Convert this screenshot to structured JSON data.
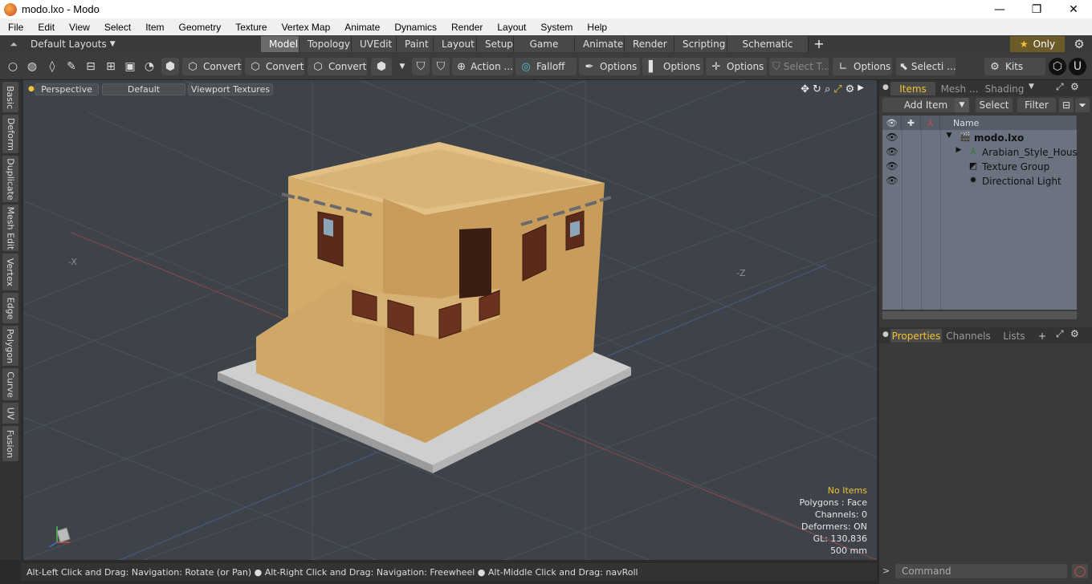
{
  "window": {
    "title": "modo.lxo - Modo",
    "minimize": "—",
    "maximize": "❐",
    "close": "✕"
  },
  "menu": [
    "File",
    "Edit",
    "View",
    "Select",
    "Item",
    "Geometry",
    "Texture",
    "Vertex Map",
    "Animate",
    "Dynamics",
    "Render",
    "Layout",
    "System",
    "Help"
  ],
  "layoutbar": {
    "layouts_label": "Default Layouts",
    "tabs": [
      "Model",
      "Topology",
      "UVEdit",
      "Paint",
      "Layout",
      "Setup",
      "Game Tools",
      "Animate",
      "Render",
      "Scripting",
      "Schematic Fusion"
    ],
    "active_tab": "Model",
    "plus": "+",
    "only_label": "Only"
  },
  "toolbar": {
    "convert1": "Convert",
    "convert2": "Convert",
    "convert3": "Convert",
    "action": "Action ...",
    "falloff": "Falloff",
    "options1": "Options",
    "options2": "Options",
    "options3": "Options",
    "select_t": "Select T...",
    "options4": "Options",
    "selecti": "Selecti ...",
    "kits": "Kits"
  },
  "left_tabs": [
    "Basic",
    "Deform",
    "Duplicate",
    "Mesh Edit",
    "Vertex",
    "Edge",
    "Polygon",
    "Curve",
    "UV",
    "Fusion"
  ],
  "viewport": {
    "view_tabs": [
      "Perspective",
      "Default",
      "Viewport Textures"
    ],
    "axis_neg_x": "-X",
    "axis_neg_z": "-Z",
    "info": {
      "no_items": "No Items",
      "polygons": "Polygons : Face",
      "channels": "Channels: 0",
      "deformers": "Deformers: ON",
      "gl": "GL: 130,836",
      "scale": "500 mm"
    }
  },
  "statusbar": {
    "text": "Alt-Left Click and Drag: Navigation: Rotate (or Pan) ● Alt-Right Click and Drag: Navigation: Freewheel ● Alt-Middle Click and Drag: navRoll"
  },
  "items_panel": {
    "tabs": [
      "Items",
      "Mesh ...",
      "Shading"
    ],
    "add_item": "Add Item",
    "select": "Select",
    "filter": "Filter",
    "name_header": "Name",
    "rows": [
      {
        "label": "modo.lxo"
      },
      {
        "label": "Arabian_Style_Hous ..."
      },
      {
        "label": "Texture Group"
      },
      {
        "label": "Directional Light"
      }
    ]
  },
  "properties_panel": {
    "tabs": [
      "Properties",
      "Channels",
      "Lists"
    ],
    "plus": "+"
  },
  "command": {
    "placeholder": "Command",
    "arrow": ">"
  },
  "colors": {
    "accent": "#f1c232",
    "viewport_bg": "#3d4348",
    "wall": "#d2aa6a",
    "base": "#c9c9c9"
  }
}
